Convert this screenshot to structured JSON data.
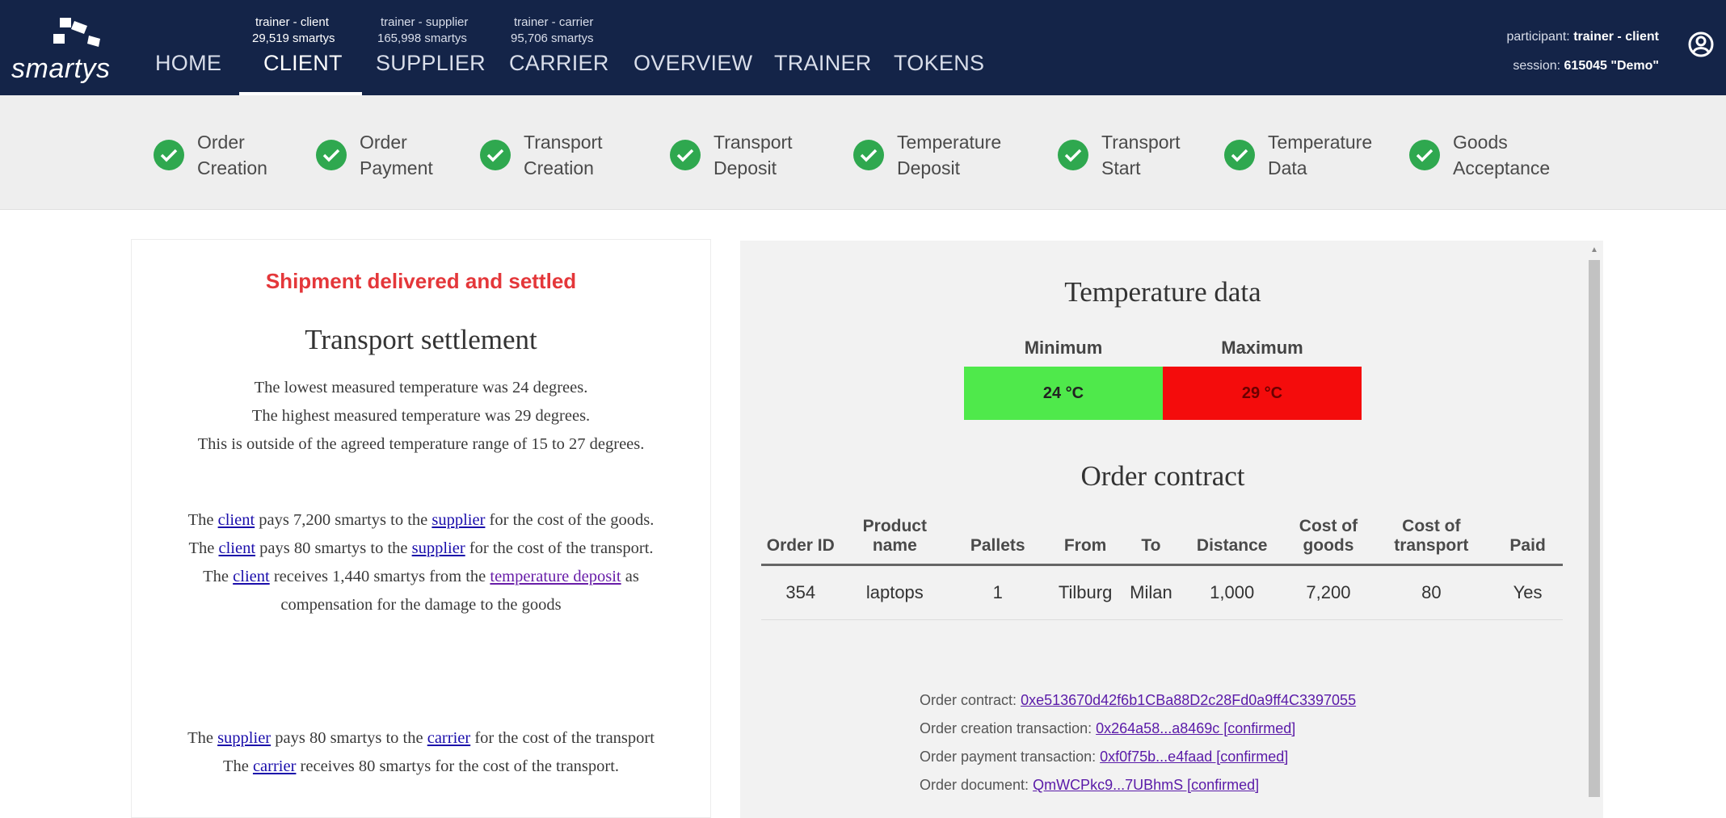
{
  "app": {
    "logo_text": "smartys"
  },
  "nav": {
    "items": [
      {
        "label": "HOME",
        "sub1": "",
        "sub2": ""
      },
      {
        "label": "CLIENT",
        "sub1": "trainer - client",
        "sub2": "29,519 smartys"
      },
      {
        "label": "SUPPLIER",
        "sub1": "trainer - supplier",
        "sub2": "165,998 smartys"
      },
      {
        "label": "CARRIER",
        "sub1": "trainer - carrier",
        "sub2": "95,706 smartys"
      },
      {
        "label": "OVERVIEW",
        "sub1": "",
        "sub2": ""
      },
      {
        "label": "TRAINER",
        "sub1": "",
        "sub2": ""
      },
      {
        "label": "TOKENS",
        "sub1": "",
        "sub2": ""
      }
    ],
    "active": "CLIENT"
  },
  "participant": {
    "participant_label": "participant:",
    "participant_value": "trainer - client",
    "session_label": "session:",
    "session_value": "615045 \"Demo\"",
    "account_icon": "account-circle-icon"
  },
  "steps": [
    {
      "line1": "Order",
      "line2": "Creation",
      "status": "done"
    },
    {
      "line1": "Order",
      "line2": "Payment",
      "status": "done"
    },
    {
      "line1": "Transport",
      "line2": "Creation",
      "status": "done"
    },
    {
      "line1": "Transport",
      "line2": "Deposit",
      "status": "done"
    },
    {
      "line1": "Temperature",
      "line2": "Deposit",
      "status": "done"
    },
    {
      "line1": "Transport",
      "line2": "Start",
      "status": "done"
    },
    {
      "line1": "Temperature",
      "line2": "Data",
      "status": "done"
    },
    {
      "line1": "Goods",
      "line2": "Acceptance",
      "status": "done"
    }
  ],
  "settlement": {
    "status": "Shipment delivered and settled",
    "title": "Transport settlement",
    "temp_lines": [
      "The lowest measured temperature was 24 degrees.",
      "The highest measured temperature was 29 degrees.",
      "This is outside of the agreed temperature range of 15 to 27 degrees."
    ],
    "p2": {
      "w_the1": "The",
      "l_client1": "client",
      "t1": "pays 7,200 smartys to the",
      "l_supplier1": "supplier",
      "t2": "for the cost of the goods.",
      "w_the2": "The",
      "l_client2": "client",
      "t3": "pays 80 smartys to the",
      "l_supplier2": "supplier",
      "t4": "for the cost of the transport.",
      "w_the3": "The",
      "l_client3": "client",
      "t5": "receives 1,440 smartys from the",
      "l_deposit": "temperature deposit",
      "t6": "as compensation for the damage to the goods"
    },
    "p3": {
      "w_the1": "The",
      "l_supplier": "supplier",
      "t1": "pays 80 smartys to the",
      "l_carrier1": "carrier",
      "t2": "for the cost of the transport",
      "w_the2": "The",
      "l_carrier2": "carrier",
      "t3": "receives 80 smartys for the cost of the transport."
    }
  },
  "temperature": {
    "title": "Temperature data",
    "min_label": "Minimum",
    "max_label": "Maximum",
    "min_value": "24 °C",
    "max_value": "29 °C",
    "min_color": "#4fe94b",
    "max_color": "#f40c0c"
  },
  "contract": {
    "title": "Order contract",
    "headers": [
      "Order ID",
      "Product name",
      "Pallets",
      "From",
      "To",
      "Distance",
      "Cost of goods",
      "Cost of transport",
      "Paid"
    ],
    "rows": [
      [
        "354",
        "laptops",
        "1",
        "Tilburg",
        "Milan",
        "1,000",
        "7,200",
        "80",
        "Yes"
      ]
    ]
  },
  "transactions": [
    {
      "label": "Order contract:",
      "value": "0xe513670d42f6b1CBa88D2c28Fd0a9ff4C3397055"
    },
    {
      "label": "Order creation transaction:",
      "value": "0x264a58...a8469c [confirmed]"
    },
    {
      "label": "Order payment transaction:",
      "value": "0xf0f75b...e4faad [confirmed]"
    },
    {
      "label": "Order document:",
      "value": "QmWCPkc9...7UBhmS [confirmed]"
    }
  ]
}
